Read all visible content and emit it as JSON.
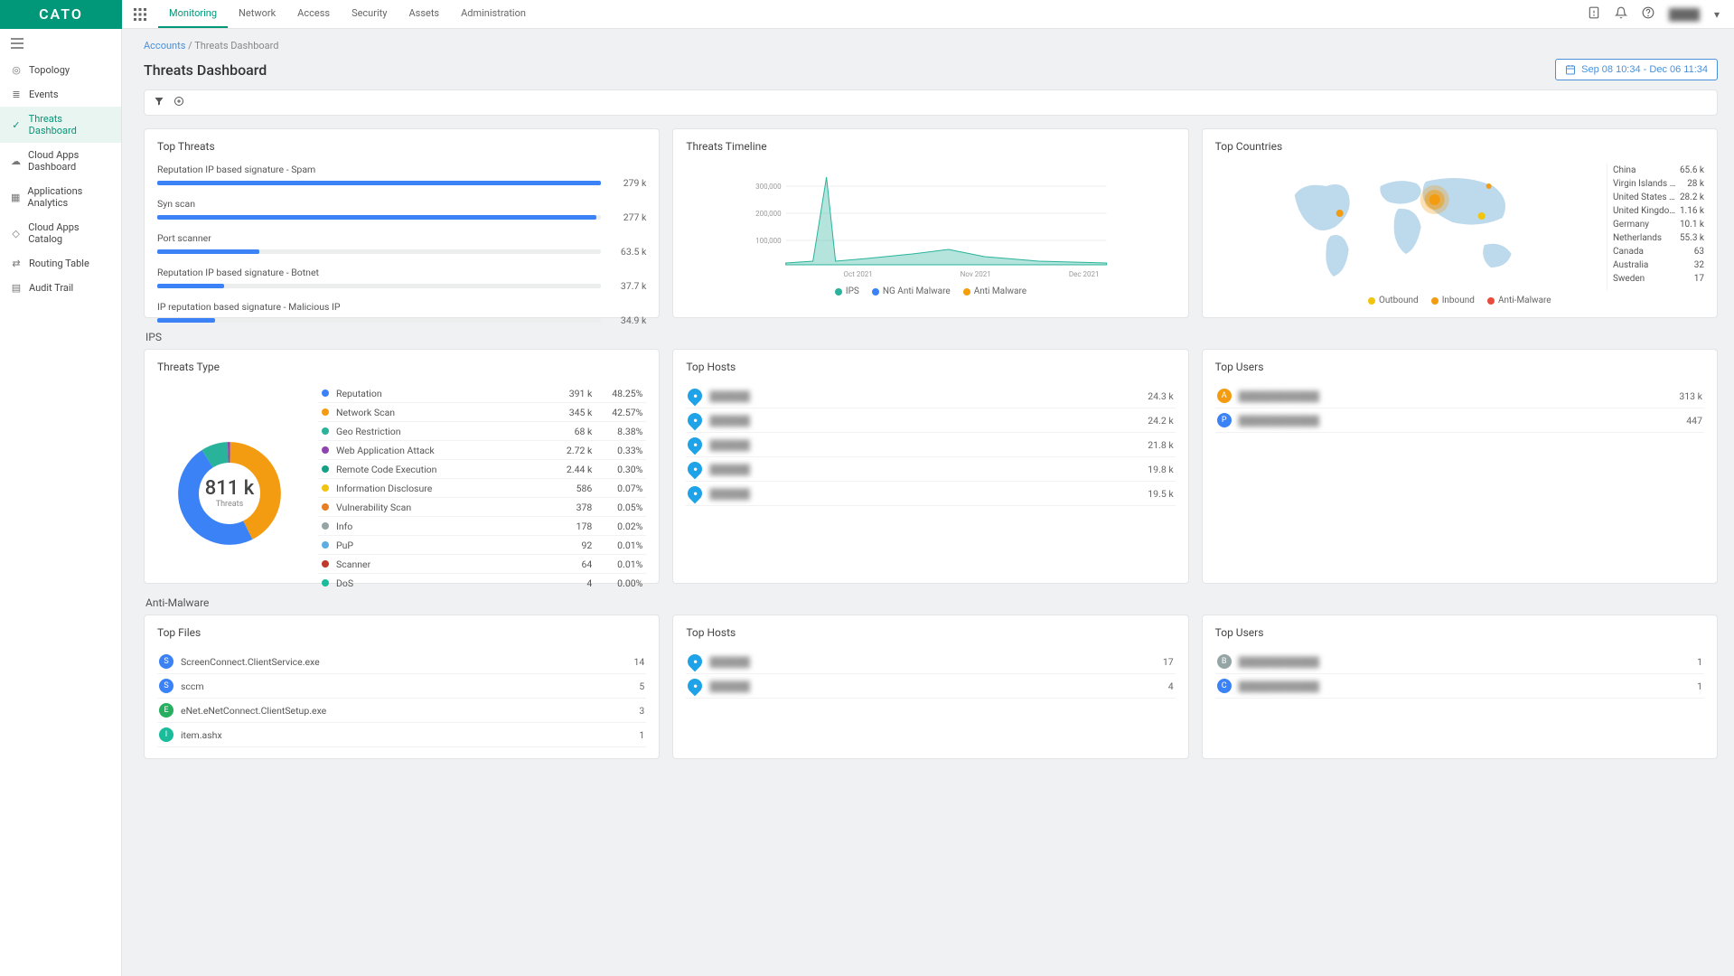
{
  "brand": "CATO",
  "topnav": [
    "Monitoring",
    "Network",
    "Access",
    "Security",
    "Assets",
    "Administration"
  ],
  "topnav_active": 0,
  "date_range": "Sep 08 10:34 - Dec 06 11:34",
  "sidebar": [
    {
      "icn": "target",
      "label": "Topology"
    },
    {
      "icn": "list",
      "label": "Events"
    },
    {
      "icn": "shield",
      "label": "Threats Dashboard"
    },
    {
      "icn": "cloud",
      "label": "Cloud Apps Dashboard"
    },
    {
      "icn": "apps",
      "label": "Applications Analytics"
    },
    {
      "icn": "cloud2",
      "label": "Cloud Apps Catalog"
    },
    {
      "icn": "route",
      "label": "Routing Table"
    },
    {
      "icn": "audit",
      "label": "Audit Trail"
    }
  ],
  "sidebar_active": 2,
  "breadcrumb": {
    "root": "Accounts",
    "current": "Threats Dashboard"
  },
  "page_title": "Threats Dashboard",
  "top_threats": {
    "title": "Top Threats",
    "items": [
      {
        "label": "Reputation IP based signature - Spam",
        "val": "279 k",
        "pct": 100
      },
      {
        "label": "Syn scan",
        "val": "277 k",
        "pct": 99
      },
      {
        "label": "Port scanner",
        "val": "63.5 k",
        "pct": 23
      },
      {
        "label": "Reputation IP based signature - Botnet",
        "val": "37.7 k",
        "pct": 15
      },
      {
        "label": "IP reputation based signature - Malicious IP",
        "val": "34.9 k",
        "pct": 13
      }
    ]
  },
  "timeline": {
    "title": "Threats Timeline",
    "legend": [
      {
        "c": "#29b39a",
        "l": "IPS"
      },
      {
        "c": "#3b82f6",
        "l": "NG Anti Malware"
      },
      {
        "c": "#f59e0b",
        "l": "Anti Malware"
      }
    ],
    "xticks": [
      "Oct 2021",
      "Nov 2021",
      "Dec 2021"
    ],
    "yticks": [
      "100,000",
      "200,000",
      "300,000"
    ]
  },
  "countries": {
    "title": "Top Countries",
    "legend": [
      {
        "c": "#f1c40f",
        "l": "Outbound"
      },
      {
        "c": "#f39c12",
        "l": "Inbound"
      },
      {
        "c": "#e74c3c",
        "l": "Anti-Malware"
      }
    ],
    "items": [
      {
        "name": "China",
        "val": "65.6 k"
      },
      {
        "name": "Virgin Islands (Briti...",
        "val": "28 k"
      },
      {
        "name": "United States of A...",
        "val": "28.2 k"
      },
      {
        "name": "United Kingdom of ...",
        "val": "1.16 k"
      },
      {
        "name": "Germany",
        "val": "10.1 k"
      },
      {
        "name": "Netherlands",
        "val": "55.3 k"
      },
      {
        "name": "Canada",
        "val": "63"
      },
      {
        "name": "Australia",
        "val": "32"
      },
      {
        "name": "Sweden",
        "val": "17"
      }
    ]
  },
  "ips_label": "IPS",
  "threats_type": {
    "title": "Threats Type",
    "center": {
      "big": "811 k",
      "small": "Threats"
    },
    "items": [
      {
        "c": "#3b82f6",
        "name": "Reputation",
        "cnt": "391 k",
        "pct": "48.25%"
      },
      {
        "c": "#f39c12",
        "name": "Network Scan",
        "cnt": "345 k",
        "pct": "42.57%"
      },
      {
        "c": "#29b39a",
        "name": "Geo Restriction",
        "cnt": "68 k",
        "pct": "8.38%"
      },
      {
        "c": "#8e44ad",
        "name": "Web Application Attack",
        "cnt": "2.72 k",
        "pct": "0.33%"
      },
      {
        "c": "#16a085",
        "name": "Remote Code Execution",
        "cnt": "2.44 k",
        "pct": "0.30%"
      },
      {
        "c": "#f1c40f",
        "name": "Information Disclosure",
        "cnt": "586",
        "pct": "0.07%"
      },
      {
        "c": "#e67e22",
        "name": "Vulnerability Scan",
        "cnt": "378",
        "pct": "0.05%"
      },
      {
        "c": "#95a5a6",
        "name": "Info",
        "cnt": "178",
        "pct": "0.02%"
      },
      {
        "c": "#5dade2",
        "name": "PuP",
        "cnt": "92",
        "pct": "0.01%"
      },
      {
        "c": "#c0392b",
        "name": "Scanner",
        "cnt": "64",
        "pct": "0.01%"
      },
      {
        "c": "#1abc9c",
        "name": "DoS",
        "cnt": "4",
        "pct": "0.00%"
      }
    ]
  },
  "top_hosts_ips": {
    "title": "Top Hosts",
    "items": [
      {
        "name": "██████",
        "val": "24.3 k"
      },
      {
        "name": "██████",
        "val": "24.2 k"
      },
      {
        "name": "██████",
        "val": "21.8 k"
      },
      {
        "name": "██████",
        "val": "19.8 k"
      },
      {
        "name": "██████",
        "val": "19.5 k"
      }
    ]
  },
  "top_users_ips": {
    "title": "Top Users",
    "items": [
      {
        "badge": "A",
        "c": "#f39c12",
        "name": "████████████",
        "val": "313 k"
      },
      {
        "badge": "P",
        "c": "#3b82f6",
        "name": "████████████",
        "val": "447"
      }
    ]
  },
  "am_label": "Anti-Malware",
  "top_files": {
    "title": "Top Files",
    "items": [
      {
        "badge": "S",
        "c": "#3b82f6",
        "name": "ScreenConnect.ClientService.exe",
        "val": "14"
      },
      {
        "badge": "S",
        "c": "#3b82f6",
        "name": "sccm",
        "val": "5"
      },
      {
        "badge": "E",
        "c": "#27ae60",
        "name": "eNet.eNetConnect.ClientSetup.exe",
        "val": "3"
      },
      {
        "badge": "I",
        "c": "#1abc9c",
        "name": "item.ashx",
        "val": "1"
      }
    ]
  },
  "top_hosts_am": {
    "title": "Top Hosts",
    "items": [
      {
        "name": "██████",
        "val": "17"
      },
      {
        "name": "██████",
        "val": "4"
      }
    ]
  },
  "top_users_am": {
    "title": "Top Users",
    "items": [
      {
        "badge": "B",
        "c": "#95a5a6",
        "name": "████████████",
        "val": "1"
      },
      {
        "badge": "C",
        "c": "#3b82f6",
        "name": "████████████",
        "val": "1"
      }
    ]
  },
  "chart_data": {
    "timeline": {
      "type": "area",
      "x_range": [
        "2021-09",
        "2021-12"
      ],
      "ylim": [
        0,
        300000
      ],
      "series": [
        {
          "name": "IPS",
          "color": "#29b39a",
          "approx_points": [
            [
              "2021-09-20",
              290000
            ],
            [
              "2021-10-05",
              20000
            ],
            [
              "2021-11-01",
              30000
            ],
            [
              "2021-12-01",
              10000
            ]
          ]
        },
        {
          "name": "NG Anti Malware",
          "color": "#3b82f6",
          "approx_points": []
        },
        {
          "name": "Anti Malware",
          "color": "#f59e0b",
          "approx_points": []
        }
      ]
    },
    "threats_type_donut": {
      "type": "pie",
      "total": "811 k",
      "slices": [
        {
          "name": "Reputation",
          "value": 391000,
          "pct": 48.25,
          "color": "#3b82f6"
        },
        {
          "name": "Network Scan",
          "value": 345000,
          "pct": 42.57,
          "color": "#f39c12"
        },
        {
          "name": "Geo Restriction",
          "value": 68000,
          "pct": 8.38,
          "color": "#29b39a"
        },
        {
          "name": "Web Application Attack",
          "value": 2720,
          "pct": 0.33,
          "color": "#8e44ad"
        },
        {
          "name": "Remote Code Execution",
          "value": 2440,
          "pct": 0.3,
          "color": "#16a085"
        },
        {
          "name": "Information Disclosure",
          "value": 586,
          "pct": 0.07,
          "color": "#f1c40f"
        },
        {
          "name": "Vulnerability Scan",
          "value": 378,
          "pct": 0.05,
          "color": "#e67e22"
        },
        {
          "name": "Info",
          "value": 178,
          "pct": 0.02,
          "color": "#95a5a6"
        },
        {
          "name": "PuP",
          "value": 92,
          "pct": 0.01,
          "color": "#5dade2"
        },
        {
          "name": "Scanner",
          "value": 64,
          "pct": 0.01,
          "color": "#c0392b"
        },
        {
          "name": "DoS",
          "value": 4,
          "pct": 0.0,
          "color": "#1abc9c"
        }
      ]
    },
    "top_threats_bars": {
      "type": "bar",
      "categories": [
        "Reputation IP based signature - Spam",
        "Syn scan",
        "Port scanner",
        "Reputation IP based signature - Botnet",
        "IP reputation based signature - Malicious IP"
      ],
      "values": [
        279000,
        277000,
        63500,
        37700,
        34900
      ]
    }
  }
}
